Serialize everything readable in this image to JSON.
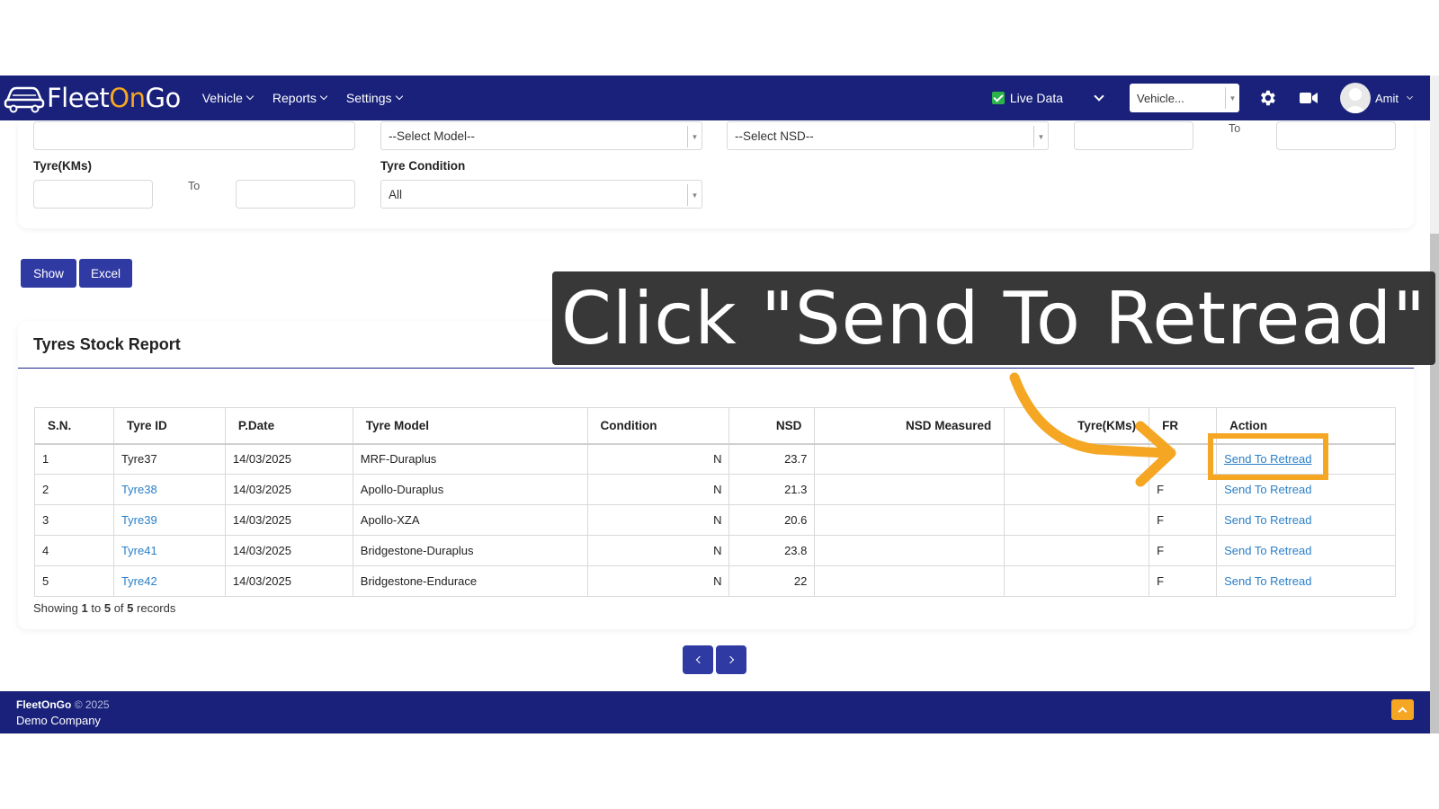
{
  "navbar": {
    "logo": {
      "part1": "Fleet",
      "part2": "On",
      "part3": "Go"
    },
    "menu": [
      {
        "label": "Vehicle"
      },
      {
        "label": "Reports"
      },
      {
        "label": "Settings"
      }
    ],
    "live_data_label": "Live Data",
    "live_data_checked": true,
    "vehicle_select_value": "Vehicle...",
    "user_name": "Amit",
    "icons": [
      "car-logo-icon",
      "gear-icon",
      "camera-icon",
      "avatar"
    ]
  },
  "filters": {
    "model_select": "--Select Model--",
    "nsd_select": "--Select NSD--",
    "to_label_1": "To",
    "tyre_kms_label": "Tyre(KMs)",
    "to_label_2": "To",
    "tyre_condition_label": "Tyre Condition",
    "tyre_condition_value": "All"
  },
  "buttons": {
    "show": "Show",
    "excel": "Excel"
  },
  "report": {
    "title": "Tyres Stock Report",
    "columns": [
      "S.N.",
      "Tyre ID",
      "P.Date",
      "Tyre Model",
      "Condition",
      "NSD",
      "NSD Measured",
      "Tyre(KMs)",
      "FR",
      "Action"
    ],
    "rows": [
      {
        "sn": "1",
        "tyre_id": "Tyre37",
        "pdate": "14/03/2025",
        "model": "MRF-Duraplus",
        "condition": "N",
        "nsd": "23.7",
        "nsd_measured": "",
        "kms": "",
        "fr": "",
        "action": "Send To Retread"
      },
      {
        "sn": "2",
        "tyre_id": "Tyre38",
        "pdate": "14/03/2025",
        "model": "Apollo-Duraplus",
        "condition": "N",
        "nsd": "21.3",
        "nsd_measured": "",
        "kms": "",
        "fr": "F",
        "action": "Send To Retread"
      },
      {
        "sn": "3",
        "tyre_id": "Tyre39",
        "pdate": "14/03/2025",
        "model": "Apollo-XZA",
        "condition": "N",
        "nsd": "20.6",
        "nsd_measured": "",
        "kms": "",
        "fr": "F",
        "action": "Send To Retread"
      },
      {
        "sn": "4",
        "tyre_id": "Tyre41",
        "pdate": "14/03/2025",
        "model": "Bridgestone-Duraplus",
        "condition": "N",
        "nsd": "23.8",
        "nsd_measured": "",
        "kms": "",
        "fr": "F",
        "action": "Send To Retread"
      },
      {
        "sn": "5",
        "tyre_id": "Tyre42",
        "pdate": "14/03/2025",
        "model": "Bridgestone-Endurace",
        "condition": "N",
        "nsd": "22",
        "nsd_measured": "",
        "kms": "",
        "fr": "F",
        "action": "Send To Retread"
      }
    ],
    "showing": {
      "prefix": "Showing",
      "from": "1",
      "to_word": "to",
      "to": "5",
      "of_word": "of",
      "total": "5",
      "suffix": "records"
    }
  },
  "footer": {
    "brand": "FleetOnGo",
    "copyright": "© 2025",
    "company": "Demo Company"
  },
  "overlay": {
    "instruction": "Click \"Send To Retread\"",
    "accent": "#f5a623"
  },
  "colors": {
    "navbar": "#19217a",
    "button": "#2f3aa3",
    "link": "#2a7fc9",
    "accent": "#f5a623"
  }
}
